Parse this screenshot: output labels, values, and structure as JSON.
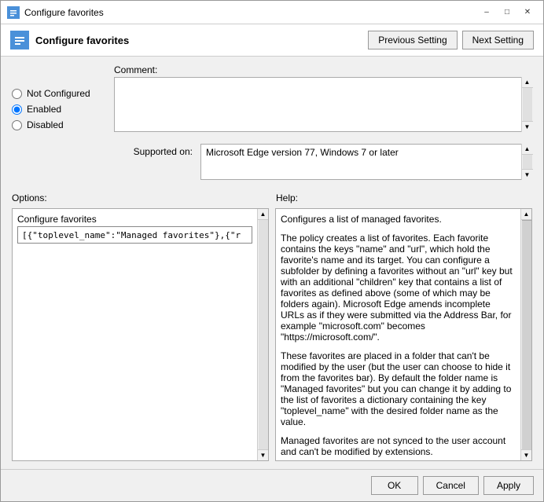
{
  "window": {
    "title": "Configure favorites",
    "header_title": "Configure favorites"
  },
  "buttons": {
    "previous_setting": "Previous Setting",
    "next_setting": "Next Setting",
    "ok": "OK",
    "cancel": "Cancel",
    "apply": "Apply"
  },
  "radio_options": {
    "not_configured": "Not Configured",
    "enabled": "Enabled",
    "disabled": "Disabled"
  },
  "fields": {
    "comment_label": "Comment:",
    "supported_label": "Supported on:",
    "supported_value": "Microsoft Edge version 77, Windows 7 or later"
  },
  "panels": {
    "options_label": "Options:",
    "help_label": "Help:",
    "options_box_title": "Configure favorites",
    "options_input_value": "[{\"toplevel_name\":\"Managed favorites\"},{\"r",
    "help_text_p1": "Configures a list of managed favorites.",
    "help_text_p2": "The policy creates a list of favorites. Each favorite contains the keys \"name\" and \"url\", which hold the favorite's name and its target. You can configure a subfolder by defining a favorites without an \"url\" key but with an additional \"children\" key that contains a list of favorites as defined above (some of which may be folders again). Microsoft Edge amends incomplete URLs as if they were submitted via the Address Bar, for example \"microsoft.com\" becomes \"https://microsoft.com/\".",
    "help_text_p3": "These favorites are placed in a folder that can't be modified by the user (but the user can choose to hide it from the favorites bar). By default the folder name is \"Managed favorites\" but you can change it by adding to the list of favorites a dictionary containing the key \"toplevel_name\" with the desired folder name as the value.",
    "help_text_p4": "Managed favorites are not synced to the user account and can't be modified by extensions."
  }
}
